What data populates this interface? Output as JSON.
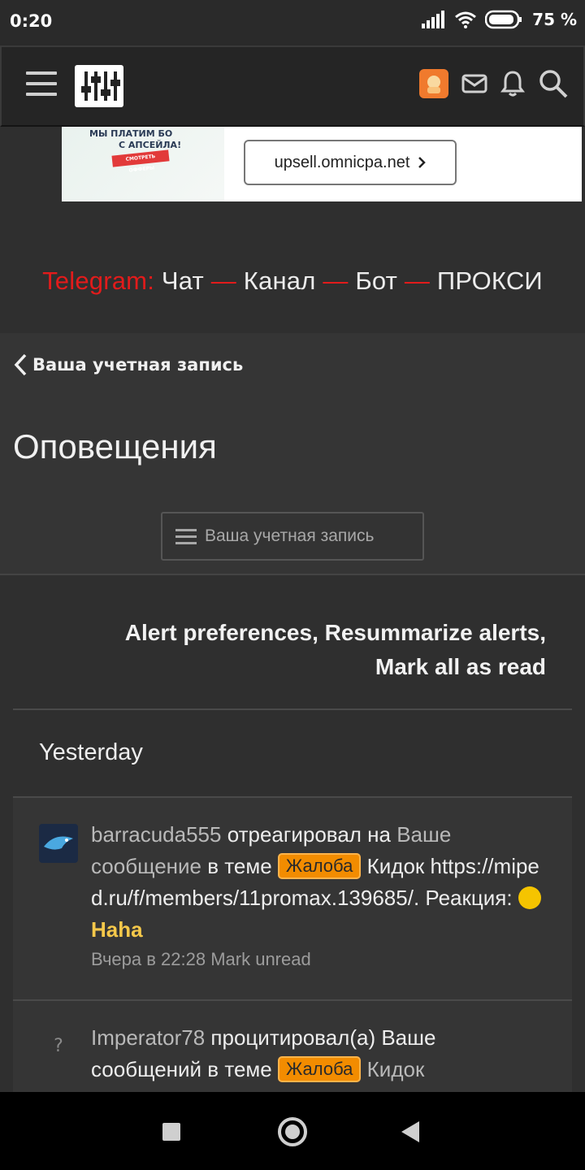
{
  "status": {
    "time": "0:20",
    "battery": "75 %"
  },
  "header": {
    "menu_icon": "hamburger-icon",
    "logo_icon": "sliders-logo-icon",
    "icons": [
      "user-avatar",
      "envelope-icon",
      "bell-icon",
      "search-icon"
    ]
  },
  "ad": {
    "line1": "МЫ ПЛАТИМ БО",
    "line2": "С АПСЕЙЛА!",
    "cta": "СМОТРЕТЬ ОФФЕРЫ",
    "button": "upsell.omnicpa.net"
  },
  "telegram": {
    "label": "Telegram:",
    "chat": "Чат",
    "dash": "—",
    "channel": "Канал",
    "bot": "Бот",
    "proxy": "ПРОКСИ"
  },
  "account": {
    "back": "Ваша учетная запись",
    "title": "Оповещения",
    "menu_button": "Ваша учетная запись"
  },
  "alerts": {
    "links_line1": "Alert preferences, Resummarize alerts,",
    "links_line2": "Mark all as read",
    "day": "Yesterday",
    "items": [
      {
        "user": "barracuda555",
        "action": " отреагировал на ",
        "target": "Ваше сообщение",
        "in_thread": " в теме ",
        "tag": "Жалоба",
        "thread": " Кидок https://miped.ru/f/members/11promax.139685/. Реакция: ",
        "reaction": "Haha",
        "time": "Вчера в 22:28",
        "mark": "Mark unread"
      },
      {
        "user": "Imperator78",
        "action": " процитировал(а) Ваше сообщений в теме ",
        "tag": "Жалоба",
        "thread": " Кидок",
        "avatar_placeholder": "?"
      }
    ]
  },
  "navbar": {
    "icons": [
      "recents-icon",
      "home-icon",
      "back-icon"
    ]
  }
}
